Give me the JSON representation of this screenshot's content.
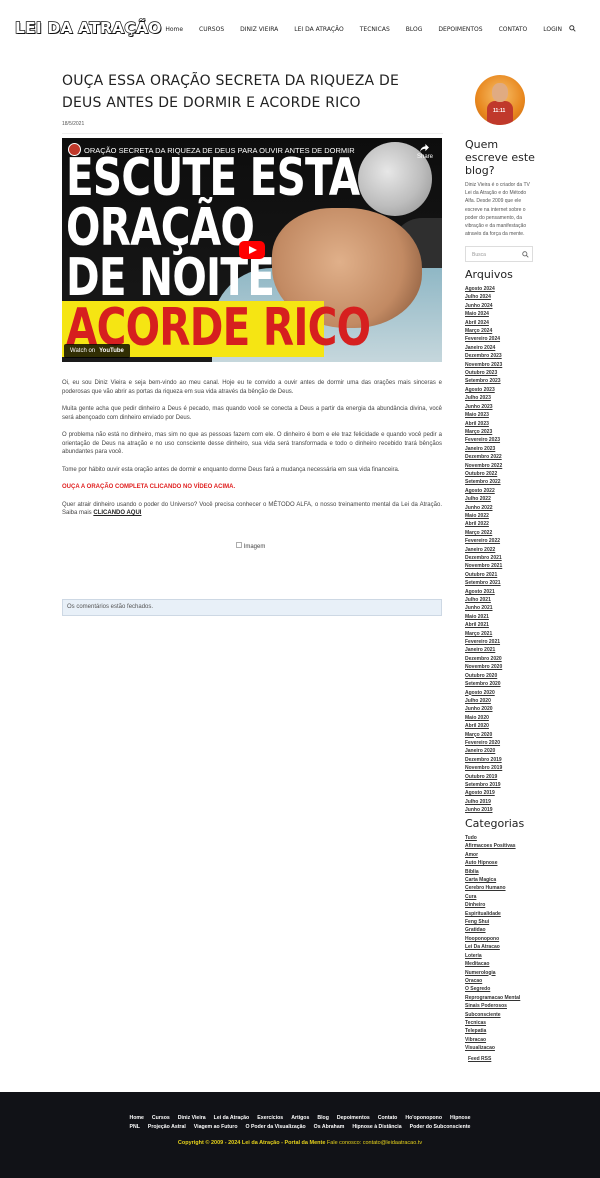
{
  "header": {
    "logo": "LEI DA ATRAÇÃO",
    "nav": [
      "Home",
      "CURSOS",
      "DINIZ VIEIRA",
      "LEI DA ATRAÇÃO",
      "TECNICAS",
      "BLOG",
      "DEPOIMENTOS",
      "CONTATO",
      "LOGIN"
    ]
  },
  "post": {
    "title": "OUÇA ESSA ORAÇÃO SECRETA DA RIQUEZA DE DEUS ANTES DE DORMIR E ACORDE RICO",
    "date": "18/5/2021",
    "video": {
      "title": "ORAÇÃO SECRETA DA RIQUEZA DE DEUS PARA OUVIR ANTES DE DORMIR",
      "line1": "ESCUTE ESTA",
      "line2": "ORAÇÃO",
      "line3": "DE NOITE",
      "line4": "ACORDE RICO",
      "share": "Share",
      "watch_on": "Watch on",
      "youtube": "YouTube"
    },
    "paragraphs": [
      "Oi, eu sou Diniz Vieira e seja bem-vindo ao meu canal. Hoje eu te convido a ouvir antes de dormir uma das orações mais sinceras e poderosas que vão abrir as portas da riqueza em sua vida através da bênção de Deus.",
      "Muita gente acha que pedir dinheiro a Deus é pecado, mas quando você se conecta a Deus a partir da energia da abundância divina, você será abençoado com dinheiro enviado por Deus.",
      "O problema não está no dinheiro, mas sim no que as pessoas fazem com ele. O dinheiro é bom e ele traz felicidade e quando você pedir a orientação de Deus na atração e no uso consciente desse dinheiro, sua vida será transformada e todo o dinheiro recebido trará bênçãos abundantes para você.",
      "Tome por hábito ouvir esta oração antes de dormir e enquanto dorme Deus fará a mudança necessária em sua vida financeira."
    ],
    "cta_red": "OUÇA A ORAÇÃO COMPLETA CLICANDO NO VÍDEO ACIMA.",
    "cta_text": "Quer atrair dinheiro usando o poder do Universo? Você precisa conhecer o MÉTODO ALFA, o nosso treinamento mental da Lei da Atração. Saiba mais ",
    "cta_link": "CLICANDO AQUI",
    "image_alt": "Imagem",
    "comments_closed": "Os comentários estão fechados."
  },
  "sidebar": {
    "who_title": "Quem escreve este blog?",
    "who_text": "Diniz Vieira é o criador da TV Lei da Atração e do Método Alfa. Desde 2009 que ele escreve na internet sobre o poder do pensamento, da vibração e da manifestação através da força da mente.",
    "search_placeholder": "Busca",
    "archives_title": "Arquivos",
    "archives": [
      "Agosto 2024",
      "Julho 2024",
      "Junho 2024",
      "Maio 2024",
      "Abril 2024",
      "Março 2024",
      "Fevereiro 2024",
      "Janeiro 2024",
      "Dezembro 2023",
      "Novembro 2023",
      "Outubro 2023",
      "Setembro 2023",
      "Agosto 2023",
      "Julho 2023",
      "Junho 2023",
      "Maio 2023",
      "Abril 2023",
      "Março 2023",
      "Fevereiro 2023",
      "Janeiro 2023",
      "Dezembro 2022",
      "Novembro 2022",
      "Outubro 2022",
      "Setembro 2022",
      "Agosto 2022",
      "Julho 2022",
      "Junho 2022",
      "Maio 2022",
      "Abril 2022",
      "Março 2022",
      "Fevereiro 2022",
      "Janeiro 2022",
      "Dezembro 2021",
      "Novembro 2021",
      "Outubro 2021",
      "Setembro 2021",
      "Agosto 2021",
      "Julho 2021",
      "Junho 2021",
      "Maio 2021",
      "Abril 2021",
      "Março 2021",
      "Fevereiro 2021",
      "Janeiro 2021",
      "Dezembro 2020",
      "Novembro 2020",
      "Outubro 2020",
      "Setembro 2020",
      "Agosto 2020",
      "Julho 2020",
      "Junho 2020",
      "Maio 2020",
      "Abril 2020",
      "Março 2020",
      "Fevereiro 2020",
      "Janeiro 2020",
      "Dezembro 2019",
      "Novembro 2019",
      "Outubro 2019",
      "Setembro 2019",
      "Agosto 2019",
      "Julho 2019",
      "Junho 2019"
    ],
    "categories_title": "Categorias",
    "categories": [
      "Tudo",
      "Afirmacoes Positivas",
      "Amor",
      "Auto Hipnose",
      "Biblia",
      "Carta Magica",
      "Cerebro Humano",
      "Cura",
      "Dinheiro",
      "Espiritualidade",
      "Feng Shui",
      "Gratidao",
      "Hooponopono",
      "Lei Da Atracao",
      "Loteria",
      "Meditacao",
      "Numerologia",
      "Oracao",
      "O Segredo",
      "Reprogramacao Mental",
      "Sinais Poderosos",
      "Subconsciente",
      "Tecnicas",
      "Telepatia",
      "Vibracao",
      "Visualizacao"
    ],
    "feed": "Feed RSS"
  },
  "footer": {
    "row1": [
      "Home",
      "Cursos",
      "Diniz Vieira",
      "Lei da Atração",
      "Exercícios",
      "Artigos",
      "Blog",
      "Depoimentos",
      "Contato",
      "Ho'oponopono",
      "Hipnose"
    ],
    "row2": [
      "PNL",
      "Projeção Astral",
      "Viagem ao Futuro",
      "O Poder da Visualização",
      "Os Abraham",
      "Hipnose à Distância",
      "Poder do Subconsciente"
    ],
    "copyright": "Copyright © 2009 - 2024 Lei da Atração - Portal da Mente",
    "contact": " Fale conosco: contato@leidaatracao.tv"
  }
}
